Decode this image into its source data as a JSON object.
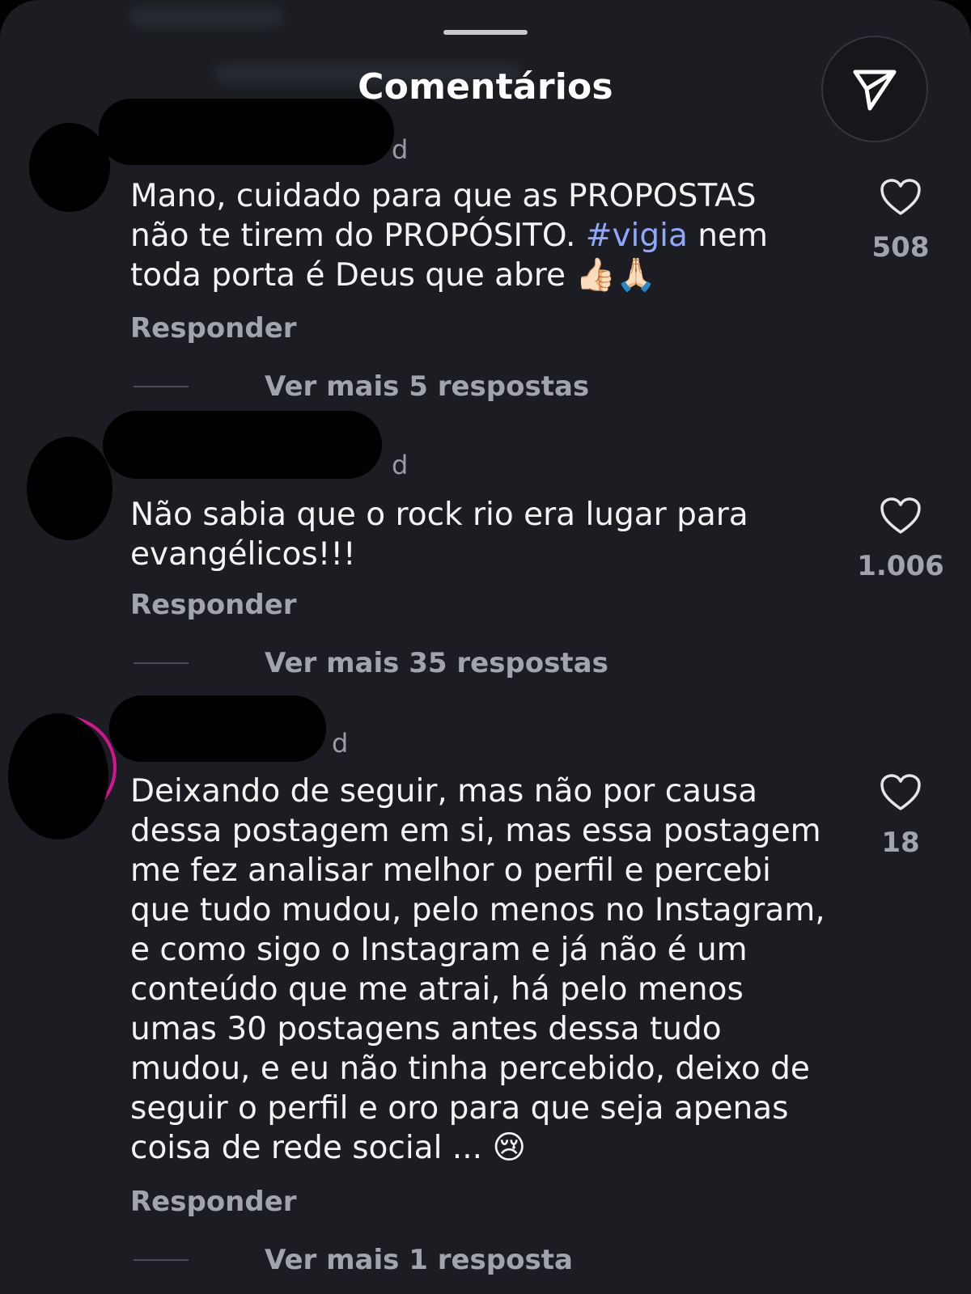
{
  "header": {
    "title": "Comentários",
    "share_icon": "send-icon"
  },
  "comments": [
    {
      "time": "d",
      "text_before": "Mano, cuidado para que as PROPOSTAS\nnão te tirem do PROPÓSITO. ",
      "hashtag": "#vigia",
      "text_after": " nem\ntoda porta é Deus que abre ",
      "emojis": "👍🏻🙏🏻",
      "reply_label": "Responder",
      "more_replies": "Ver mais 5 respostas",
      "likes": "508",
      "like_icon": "heart-icon"
    },
    {
      "time": "d",
      "text": "Não sabia que o rock rio era lugar para\nevangélicos!!!",
      "reply_label": "Responder",
      "more_replies": "Ver mais 35 respostas",
      "likes": "1.006",
      "like_icon": "heart-icon"
    },
    {
      "time": "d",
      "text": "Deixando de seguir, mas não por causa\ndessa postagem em si, mas essa postagem\nme fez analisar melhor o perfil e percebi\nque tudo mudou, pelo menos no Instagram,\ne como sigo o Instagram e já não é um\nconteúdo que me atrai, há pelo menos\numas 30 postagens antes dessa tudo\nmudou, e eu não tinha percebido, deixo de\nseguir o perfil e oro para que seja apenas\ncoisa de rede social ... ",
      "emoji": "😢",
      "reply_label": "Responder",
      "more_replies": "Ver mais 1 resposta",
      "likes": "18",
      "like_icon": "heart-icon"
    }
  ],
  "colors": {
    "background": "#1b1d22",
    "hashtag": "#8ea8ff",
    "muted": "#a2a4ab"
  }
}
